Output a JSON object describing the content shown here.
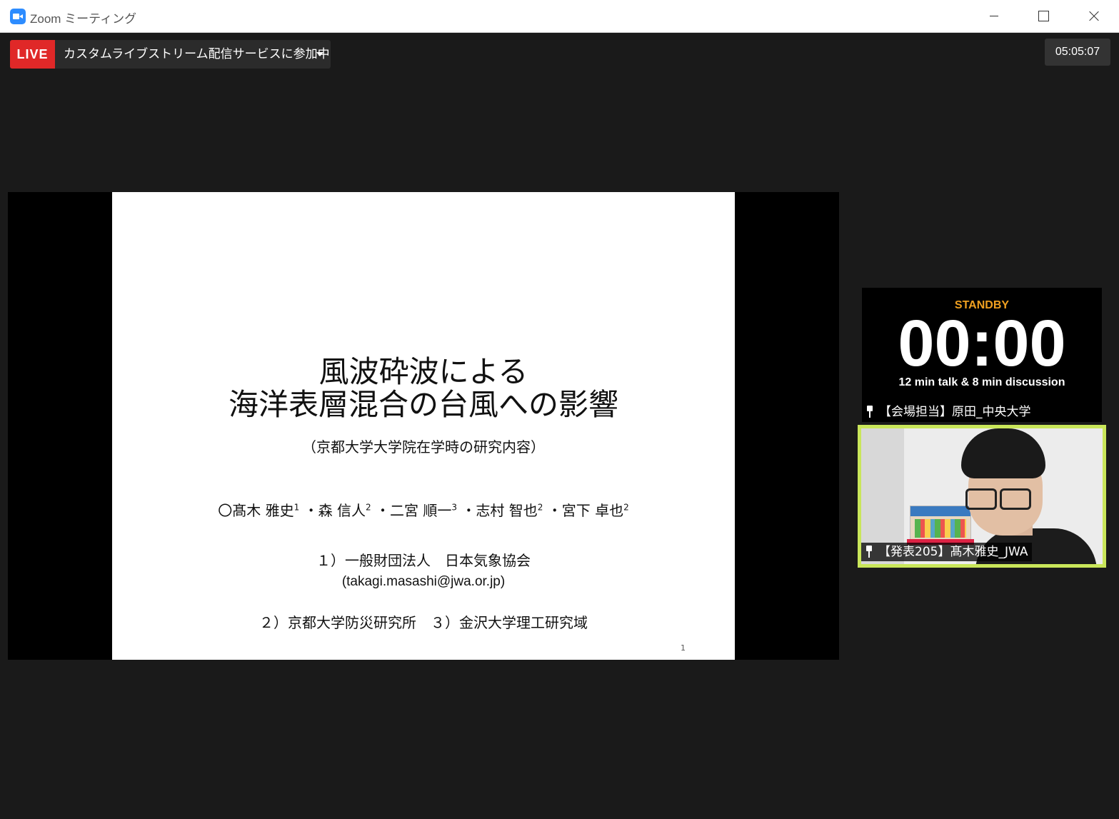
{
  "window": {
    "title": "Zoom ミーティング"
  },
  "live": {
    "badge": "LIVE",
    "status": "カスタムライブストリーム配信サービスに参加中"
  },
  "elapsed_time": "05:05:07",
  "slide": {
    "title_line1": "風波砕波による",
    "title_line2": "海洋表層混合の台風への影響",
    "subtitle": "（京都大学大学院在学時の研究内容）",
    "authors": [
      {
        "name": "〇髙木 雅史",
        "aff": "1"
      },
      {
        "name": "・森 信人",
        "aff": "2"
      },
      {
        "name": "・二宮 順一",
        "aff": "3"
      },
      {
        "name": "・志村 智也",
        "aff": "2"
      },
      {
        "name": "・宮下 卓也",
        "aff": "2"
      }
    ],
    "affiliation1": "１）一般財団法人　日本気象協会",
    "email": "(takagi.masashi@jwa.or.jp)",
    "affiliation2": "２）京都大学防災研究所　３）金沢大学理工研究域",
    "page_number": "1"
  },
  "participants": [
    {
      "name": "【会場担当】原田_中央大学",
      "standby": "STANDBY",
      "timer": "00:00",
      "talk_info": "12 min talk & 8 min discussion"
    },
    {
      "name": "【発表205】髙木雅史_JWA",
      "active_speaker_color": "#c9e65a"
    }
  ]
}
